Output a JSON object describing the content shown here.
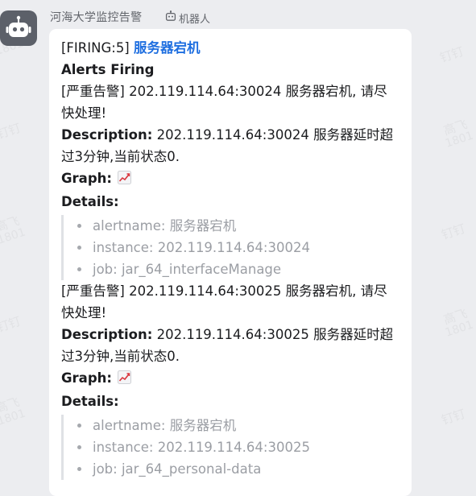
{
  "sender": {
    "name": "河海大学监控告警",
    "tag_label": "机器人"
  },
  "watermark": {
    "line1": "高飞",
    "line2": "1801",
    "line_alt": "钉钉"
  },
  "message": {
    "firing_prefix": "[FIRING:5]",
    "title_link": "服务器宕机",
    "alerts_heading": "Alerts Firing",
    "alerts": [
      {
        "summary": "[严重告警] 202.119.114.64:30024 服务器宕机, 请尽快处理!",
        "description_label": "Description:",
        "description": "202.119.114.64:30024 服务器延时超过3分钟,当前状态0.",
        "graph_label": "Graph:",
        "details_label": "Details:",
        "details": [
          "alertname: 服务器宕机",
          "instance: 202.119.114.64:30024",
          "job: jar_64_interfaceManage"
        ]
      },
      {
        "summary": "[严重告警] 202.119.114.64:30025 服务器宕机, 请尽快处理!",
        "description_label": "Description:",
        "description": "202.119.114.64:30025 服务器延时超过3分钟,当前状态0.",
        "graph_label": "Graph:",
        "details_label": "Details:",
        "details": [
          "alertname: 服务器宕机",
          "instance: 202.119.114.64:30025",
          "job: jar_64_personal-data"
        ]
      }
    ]
  },
  "icons": {
    "avatar": "robot-icon",
    "tag": "robot-tag-icon",
    "graph": "chart-increasing-icon"
  },
  "colors": {
    "background": "#ecedf0",
    "link": "#1f6fe0",
    "detail_text": "#9b9ea4",
    "avatar_bg": "#5c6069"
  }
}
